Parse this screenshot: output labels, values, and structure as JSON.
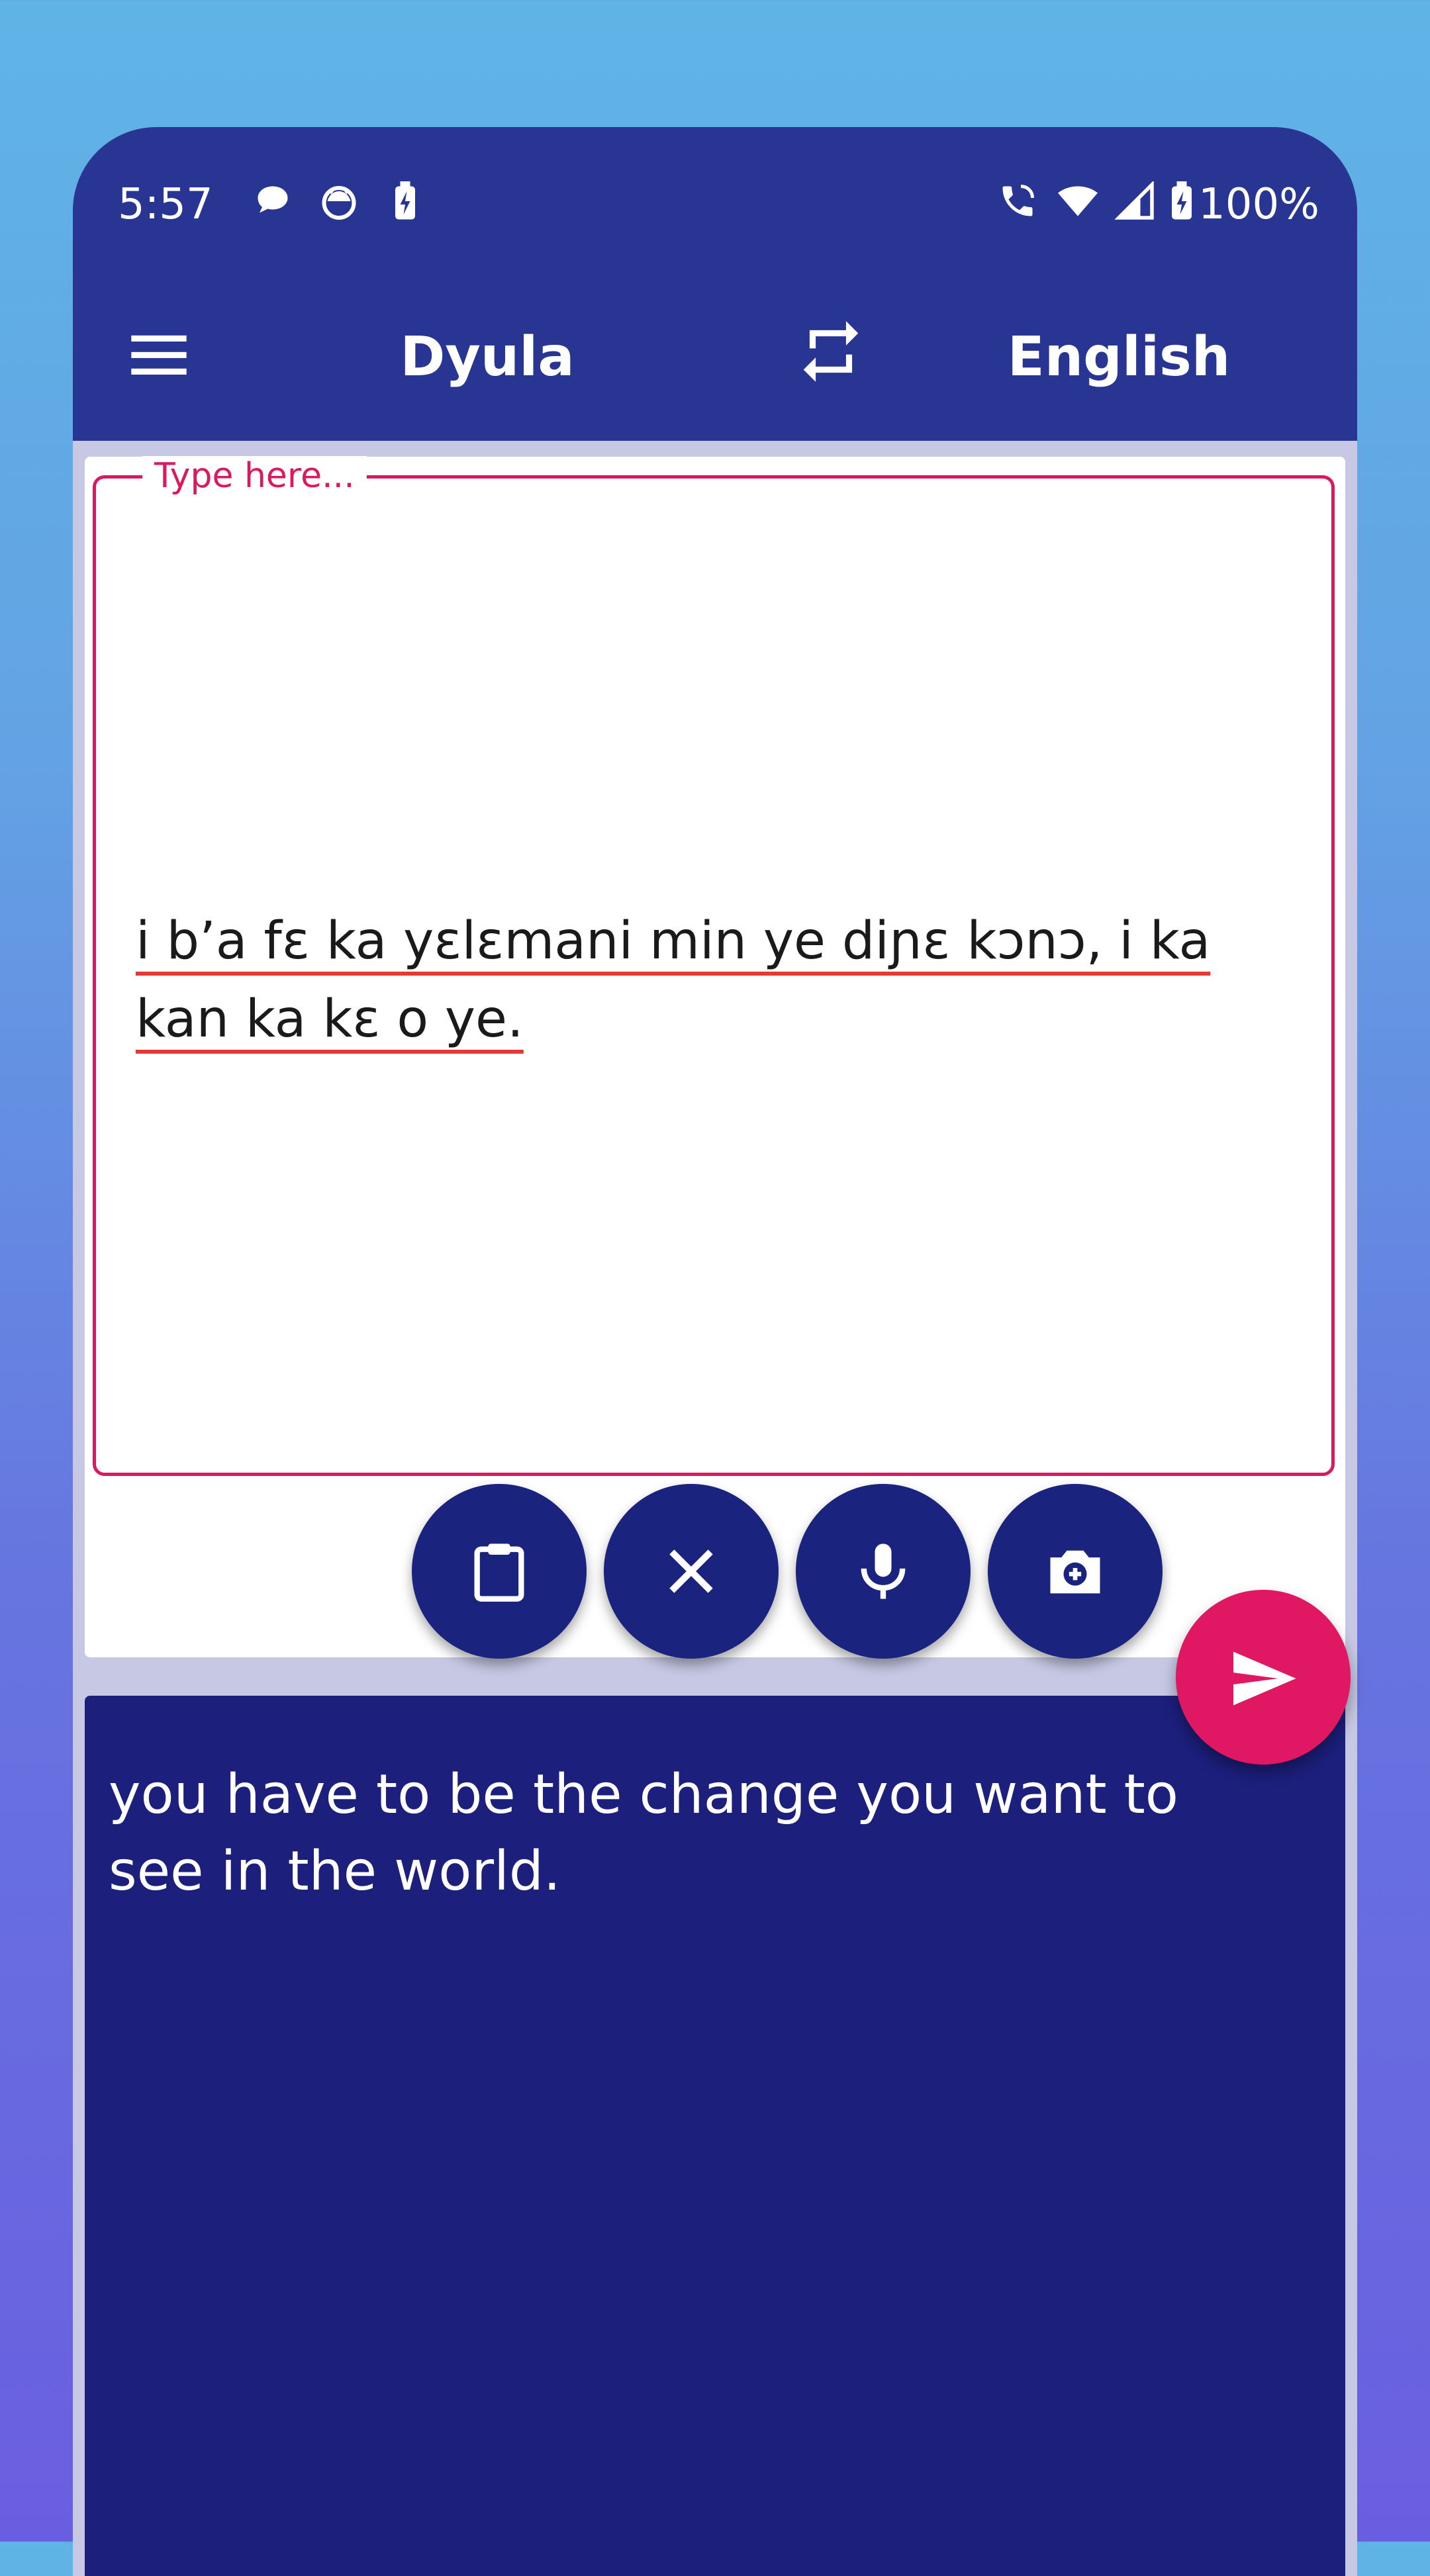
{
  "status_bar": {
    "time": "5:57",
    "battery_percent": "100%",
    "left_icons": [
      "chat-bubble-icon",
      "android-face-icon",
      "battery-charging-icon"
    ],
    "right_icons": [
      "wifi-call-icon",
      "wifi-icon",
      "cell-signal-icon",
      "battery-icon"
    ]
  },
  "toolbar": {
    "menu_icon": "hamburger-menu-icon",
    "source_language": "Dyula",
    "target_language": "English",
    "swap_icon": "swap-languages-icon",
    "background": "#283593"
  },
  "input": {
    "label": "Type here...",
    "text": "i b’a fɛ ka yɛlɛmani min ye diɲɛ kɔnɔ, i ka kan ka kɛ o ye.",
    "accent": "#d81b60"
  },
  "actions": [
    {
      "name": "paste",
      "icon": "clipboard-icon"
    },
    {
      "name": "clear",
      "icon": "close-icon"
    },
    {
      "name": "voice",
      "icon": "microphone-icon"
    },
    {
      "name": "camera",
      "icon": "camera-icon"
    }
  ],
  "send_button": {
    "icon": "send-icon",
    "color": "#e01762"
  },
  "output": {
    "text": "you have to be the change you want to see in the world.",
    "background": "#1c1f7c"
  }
}
